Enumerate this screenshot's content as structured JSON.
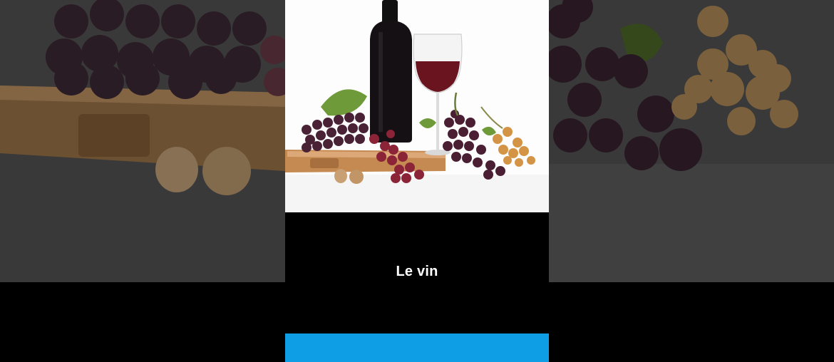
{
  "card": {
    "title": "Le vin",
    "image_icon": "wine-bottle-grapes-illustration",
    "action_label": ""
  },
  "colors": {
    "accent": "#0e9ee6",
    "background": "#000000",
    "title_text": "#ffffff"
  }
}
